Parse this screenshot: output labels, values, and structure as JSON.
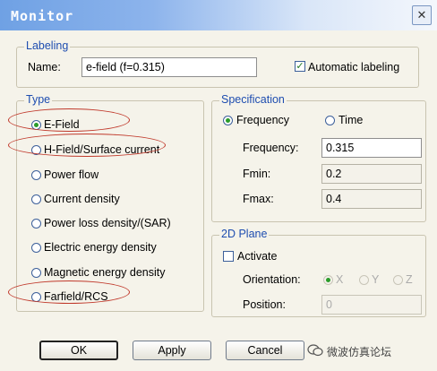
{
  "window": {
    "title": "Monitor",
    "close_glyph": "✕"
  },
  "labeling": {
    "group_title": "Labeling",
    "name_label": "Name:",
    "name_value": "e-field (f=0.315)",
    "auto_label": "Automatic labeling",
    "auto_checked": true
  },
  "type": {
    "group_title": "Type",
    "options": [
      {
        "label": "E-Field",
        "selected": true
      },
      {
        "label": "H-Field/Surface current",
        "selected": false
      },
      {
        "label": "Power flow",
        "selected": false
      },
      {
        "label": "Current density",
        "selected": false
      },
      {
        "label": "Power loss density/(SAR)",
        "selected": false
      },
      {
        "label": "Electric energy density",
        "selected": false
      },
      {
        "label": "Magnetic energy density",
        "selected": false
      },
      {
        "label": "Farfield/RCS",
        "selected": false
      }
    ]
  },
  "specification": {
    "group_title": "Specification",
    "mode_frequency": "Frequency",
    "mode_time": "Time",
    "selected_mode": "Frequency",
    "frequency_label": "Frequency:",
    "frequency_value": "0.315",
    "fmin_label": "Fmin:",
    "fmin_value": "0.2",
    "fmax_label": "Fmax:",
    "fmax_value": "0.4"
  },
  "plane2d": {
    "group_title": "2D Plane",
    "activate_label": "Activate",
    "activate_checked": false,
    "orientation_label": "Orientation:",
    "orientation_options": [
      "X",
      "Y",
      "Z"
    ],
    "orientation_selected": "X",
    "position_label": "Position:",
    "position_value": "0"
  },
  "buttons": {
    "ok": "OK",
    "apply": "Apply",
    "cancel": "Cancel"
  },
  "watermark": {
    "text": "微波仿真论坛",
    "icon": "wechat-icon"
  },
  "colors": {
    "group_title": "#1e4db0",
    "radio_selected": "#2a9c2a",
    "annotation": "#c0392b"
  }
}
